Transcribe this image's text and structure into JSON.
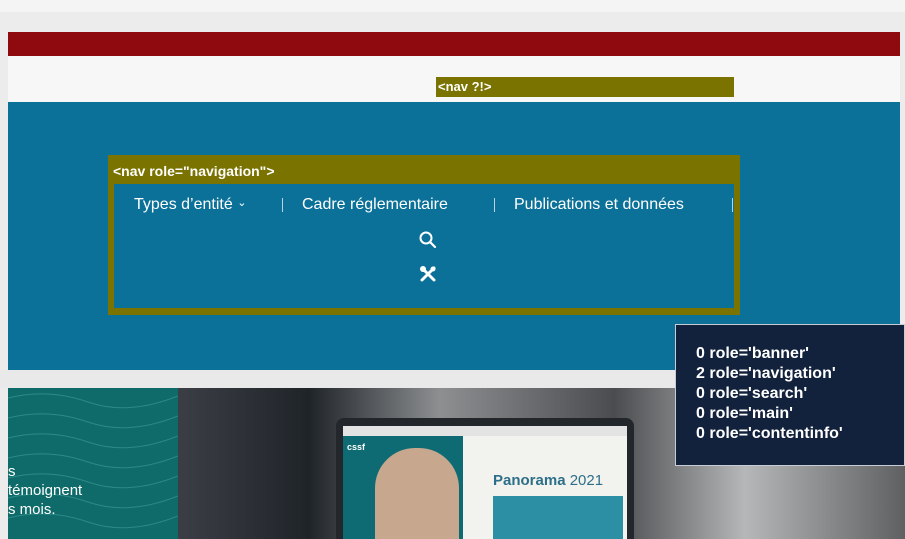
{
  "overlays": {
    "nav_small_label": "<nav ?!>",
    "nav_main_label": "<nav role=\"navigation\">"
  },
  "nav": {
    "items": [
      {
        "label": "Types d’entité",
        "caret": "⌄"
      },
      {
        "label": "Cadre réglementaire"
      },
      {
        "label": "Publications et données"
      }
    ],
    "icons": [
      "search-icon",
      "tools-icon"
    ]
  },
  "hero": {
    "text_lines": [
      "s",
      "témoignent",
      "s mois."
    ],
    "screen": {
      "logo": "cssf",
      "brand": "Panorama",
      "brand_year": "2021"
    }
  },
  "roles_panel": {
    "lines": [
      "0 role='banner'",
      "2 role='navigation'",
      "0 role='search'",
      "0 role='main'",
      "0 role='contentinfo'"
    ]
  },
  "colors": {
    "red_bar": "#8f0a0f",
    "blue": "#0b7199",
    "olive_overlay": "#7a7300",
    "panel": "#12213c"
  }
}
